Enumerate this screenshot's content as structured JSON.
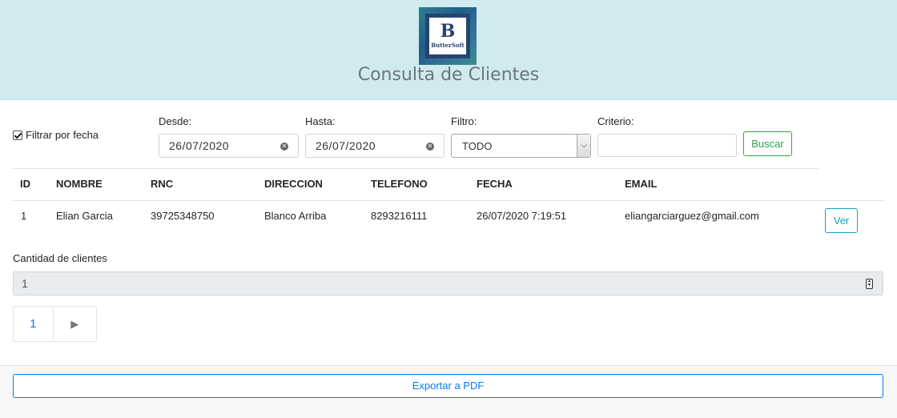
{
  "header": {
    "logo_letter": "B",
    "logo_text": "ButterSoft",
    "title": "Consulta de Clientes"
  },
  "filters": {
    "filter_by_date_label": "Filtrar por fecha",
    "filter_by_date_checked": true,
    "desde_label": "Desde:",
    "desde_value": "26/07/2020",
    "hasta_label": "Hasta:",
    "hasta_value": "26/07/2020",
    "filtro_label": "Filtro:",
    "filtro_value": "TODO",
    "criterio_label": "Criterio:",
    "criterio_value": "",
    "buscar_label": "Buscar"
  },
  "table": {
    "columns": [
      "ID",
      "NOMBRE",
      "RNC",
      "DIRECCION",
      "TELEFONO",
      "FECHA",
      "EMAIL"
    ],
    "rows": [
      {
        "id": "1",
        "nombre": "Elian Garcia",
        "rnc": "39725348750",
        "direccion": "Blanco Arriba",
        "telefono": "8293216111",
        "fecha": "26/07/2020 7:19:51",
        "email": "eliangarciarguez@gmail.com",
        "action_label": "Ver"
      }
    ]
  },
  "count": {
    "label": "Cantidad de clientes",
    "value": "1"
  },
  "pagination": {
    "current_page": "1",
    "next_symbol": "▶"
  },
  "footer": {
    "export_label": "Exportar a PDF"
  },
  "colors": {
    "header_bg": "#d1eaf0",
    "buscar": "#28a745",
    "ver": "#17a2b8",
    "primary": "#007bff"
  }
}
